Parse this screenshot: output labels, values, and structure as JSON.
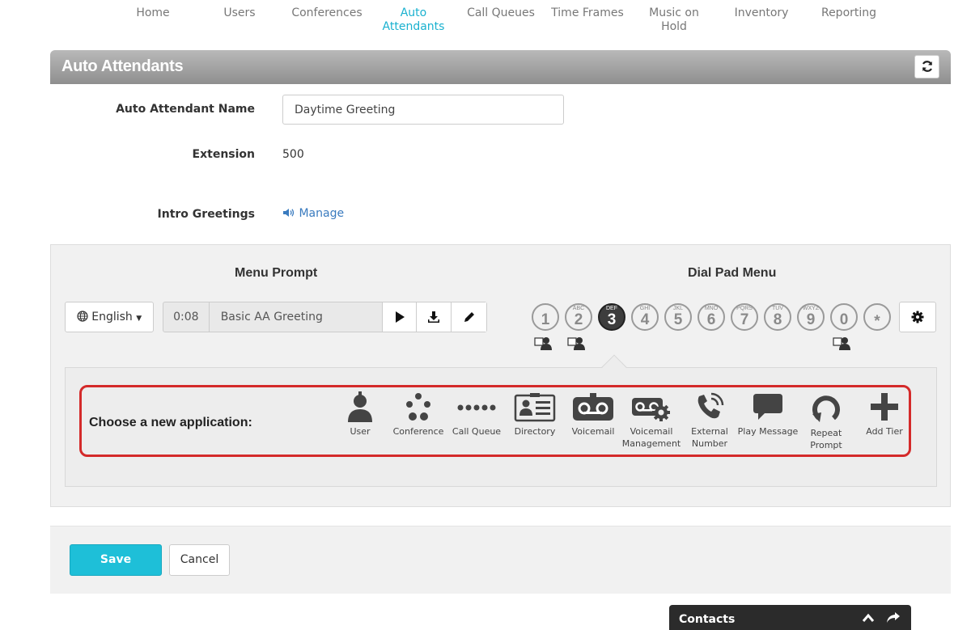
{
  "nav": {
    "items": [
      {
        "label": "Home"
      },
      {
        "label": "Users"
      },
      {
        "label": "Conferences"
      },
      {
        "label": "Auto Attendants",
        "active": true
      },
      {
        "label": "Call Queues"
      },
      {
        "label": "Time Frames"
      },
      {
        "label": "Music on Hold"
      },
      {
        "label": "Inventory"
      },
      {
        "label": "Reporting"
      }
    ]
  },
  "header": {
    "title": "Auto Attendants",
    "refresh_icon": "refresh-icon"
  },
  "form": {
    "name_label": "Auto Attendant Name",
    "name_value": "Daytime Greeting",
    "extension_label": "Extension",
    "extension_value": "500",
    "intro_label": "Intro Greetings",
    "manage_label": "Manage"
  },
  "panel": {
    "menu_prompt_title": "Menu Prompt",
    "dial_pad_title": "Dial Pad Menu",
    "language": "English",
    "prompt_time": "0:08",
    "prompt_name": "Basic AA Greeting",
    "keys": [
      {
        "num": "1",
        "letters": ""
      },
      {
        "num": "2",
        "letters": "ABC"
      },
      {
        "num": "3",
        "letters": "DEF",
        "selected": true
      },
      {
        "num": "4",
        "letters": "GHI"
      },
      {
        "num": "5",
        "letters": "JKL"
      },
      {
        "num": "6",
        "letters": "MNO"
      },
      {
        "num": "7",
        "letters": "PQRS"
      },
      {
        "num": "8",
        "letters": "TUV"
      },
      {
        "num": "9",
        "letters": "WXYZ"
      },
      {
        "num": "0",
        "letters": ""
      },
      {
        "num": "*",
        "letters": ""
      }
    ]
  },
  "apps": {
    "choose_label": "Choose a new application:",
    "items": [
      {
        "label": "User",
        "icon": "user-icon"
      },
      {
        "label": "Conference",
        "icon": "conference-icon"
      },
      {
        "label": "Call Queue",
        "icon": "call-queue-icon"
      },
      {
        "label": "Directory",
        "icon": "directory-icon"
      },
      {
        "label": "Voicemail",
        "icon": "voicemail-icon"
      },
      {
        "label": "Voicemail Management",
        "icon": "voicemail-management-icon"
      },
      {
        "label": "External Number",
        "icon": "phone-icon"
      },
      {
        "label": "Play Message",
        "icon": "speech-bubble-icon"
      },
      {
        "label": "Repeat Prompt",
        "icon": "repeat-icon"
      },
      {
        "label": "Add Tier",
        "icon": "plus-icon"
      }
    ]
  },
  "footer": {
    "save_label": "Save",
    "cancel_label": "Cancel"
  },
  "contacts": {
    "title": "Contacts"
  },
  "colors": {
    "accent": "#1ab1cf",
    "save": "#1ebfd8",
    "highlight": "#d42a2a",
    "link": "#3a7bbf"
  }
}
